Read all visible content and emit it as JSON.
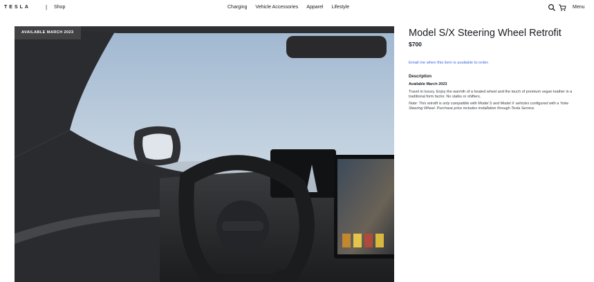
{
  "header": {
    "logo": "TESLA",
    "separator": "|",
    "shop_label": "Shop",
    "nav": [
      "Charging",
      "Vehicle Accessories",
      "Apparel",
      "Lifestyle"
    ],
    "search_icon": "search-icon",
    "cart_icon": "cart-icon",
    "menu_label": "Menu"
  },
  "product": {
    "badge": "AVAILABLE MARCH 2023",
    "title": "Model S/X Steering Wheel Retrofit",
    "price": "$700",
    "notify_link": "Email me when this item is available to order.",
    "description_heading": "Description",
    "availability": "Available March 2023",
    "body": "Travel in luxury. Enjoy the warmth of a heated wheel and the touch of premium vegan leather in a traditional form factor. No stalks or shifters.",
    "note": "Note: This retrofit is only compatible with Model S and Model X vehicles configured with a Yoke Steering Wheel. Purchase price includes installation through Tesla Service."
  },
  "colors": {
    "text": "#171a20",
    "link": "#3e6ae1",
    "badge_bg": "#464648"
  }
}
